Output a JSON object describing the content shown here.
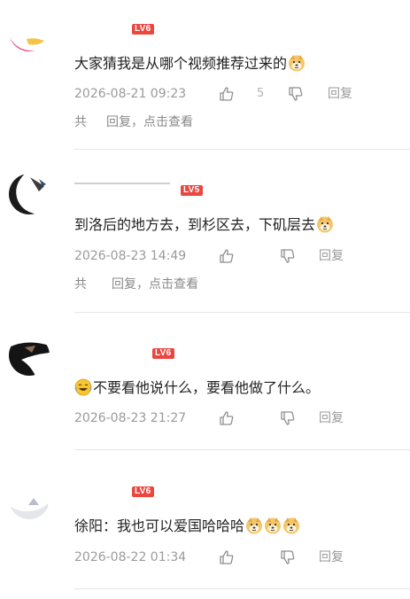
{
  "comments": [
    {
      "level": "LV6",
      "text": "大家猜我是从哪个视频推荐过来的",
      "emojis": [
        "doge"
      ],
      "date": "2026-08-21 09:23",
      "like_count": "5",
      "reply_label": "回复",
      "replies_text": "回复，点击查看",
      "replies_prefix": "共"
    },
    {
      "level": "LV5",
      "text": "到洛后的地方去，到杉区去，下矶层去",
      "emojis": [
        "doge"
      ],
      "date": "2026-08-23 14:49",
      "reply_label": "回复",
      "replies_text": "回复，点击查看",
      "replies_prefix": "共"
    },
    {
      "level": "LV6",
      "text": "不要看他说什么，要看他做了什么。",
      "emojis": [
        "laugh-cry"
      ],
      "date": "2026-08-23 21:27",
      "reply_label": "回复"
    },
    {
      "level": "LV6",
      "text": "徐阳：我也可以爱国哈哈哈",
      "emojis": [
        "doge",
        "doge",
        "doge"
      ],
      "date": "2026-08-22 01:34",
      "reply_label": "回复"
    }
  ],
  "icons": {
    "like": "thumbs-up-icon",
    "dislike": "thumbs-down-icon",
    "doge": "doge-emoji-icon",
    "laugh": "laugh-cry-emoji-icon"
  },
  "colors": {
    "level_badge": "#e9473f",
    "text": "#222222",
    "meta": "#9a9a9a",
    "divider": "#e6e6e6"
  }
}
